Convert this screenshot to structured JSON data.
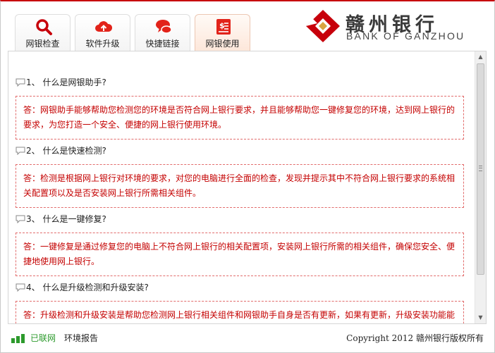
{
  "colors": {
    "brand_red": "#c7000b",
    "answer_red": "#c40000",
    "online_green": "#2c9a2c"
  },
  "tabs": [
    {
      "label": "网银检查",
      "icon": "search-icon"
    },
    {
      "label": "软件升级",
      "icon": "cloud-upload-icon"
    },
    {
      "label": "快捷链接",
      "icon": "chat-bubble-icon"
    },
    {
      "label": "网银使用",
      "icon": "receipt-icon",
      "active": true
    }
  ],
  "logo": {
    "cn": "赣州银行",
    "en": "BANK OF GANZHOU"
  },
  "faq": [
    {
      "q": "1、 什么是网银助手?",
      "a": "答：网银助手能够帮助您检测您的环境是否符合网上银行要求，并且能够帮助您一键修复您的环境，达到网上银行的要求，为您打造一个安全、便捷的网上银行使用环境。"
    },
    {
      "q": "2、 什么是快速检测?",
      "a": "答：检测是根据网上银行对环境的要求，对您的电脑进行全面的检查，发现并提示其中不符合网上银行要求的系统相关配置项以及是否安装网上银行所需相关组件。"
    },
    {
      "q": "3、 什么是一键修复?",
      "a": "答：一键修复是通过修复您的电脑上不符合网上银行的相关配置项，安装网上银行所需的相关组件，确保您安全、便捷地使用网上银行。"
    },
    {
      "q": "4、 什么是升级检测和升级安装?",
      "a": "答：升级检测和升级安装是帮助您检测网上银行相关组件和网银助手自身是否有更新，如果有更新，升级安装功能能够帮助您一键升级安装最新版本的网上银行相关组件。"
    }
  ],
  "status": {
    "online": "已联网",
    "report": "环境报告",
    "copyright": "Copyright 2012 赣州银行版权所有"
  }
}
